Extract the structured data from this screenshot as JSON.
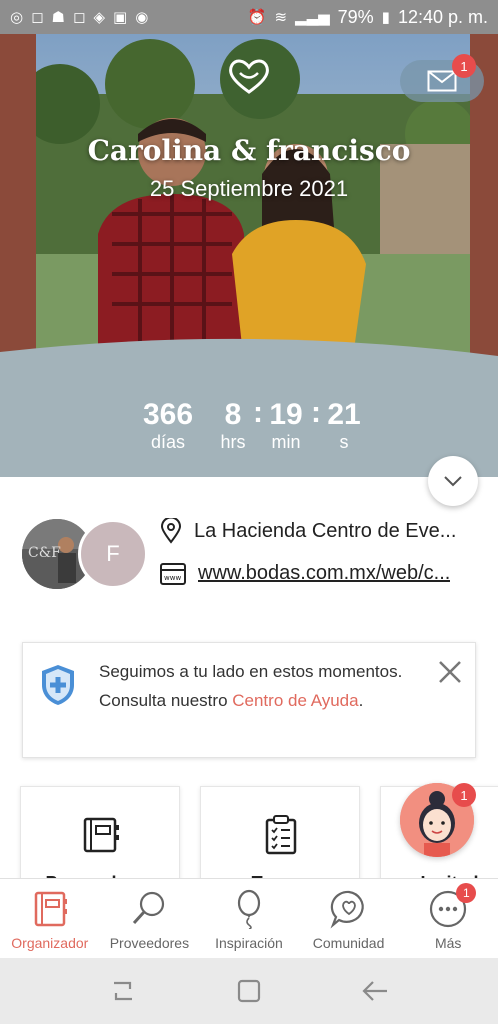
{
  "status_bar": {
    "battery": "79%",
    "time": "12:40 p. m."
  },
  "hero": {
    "couple_names": "Carolina & francisco",
    "date": "25 Septiembre 2021",
    "mail_badge": "1",
    "countdown": {
      "days": "366",
      "days_label": "días",
      "hours": "8",
      "hours_label": "hrs",
      "minutes": "19",
      "minutes_label": "min",
      "seconds": "21",
      "seconds_label": "s"
    }
  },
  "info": {
    "avatar_initial": "F",
    "venue": "La Hacienda Centro de Eve...",
    "website": "www.bodas.com.mx/web/c..."
  },
  "help_card": {
    "text_before": "Seguimos a tu lado en estos momentos. Consulta nuestro ",
    "link_text": "Centro de Ayuda",
    "text_after": "."
  },
  "tools": [
    {
      "label": "Proveedores",
      "icon": "notebook-icon"
    },
    {
      "label": "Tareas",
      "icon": "checklist-icon"
    },
    {
      "label": "Invitados",
      "icon": "guests-icon"
    }
  ],
  "assistant_badge": "1",
  "bottom_nav": {
    "items": [
      {
        "label": "Organizador",
        "icon": "planner-book-icon",
        "active": true
      },
      {
        "label": "Proveedores",
        "icon": "magnifier-icon"
      },
      {
        "label": "Inspiración",
        "icon": "balloon-icon"
      },
      {
        "label": "Comunidad",
        "icon": "chat-heart-icon"
      },
      {
        "label": "Más",
        "icon": "more-dots-icon",
        "badge": "1"
      }
    ]
  },
  "colors": {
    "accent": "#e06a5e",
    "badge": "#e74c4c",
    "countdown_band": "#a3b3ba"
  }
}
